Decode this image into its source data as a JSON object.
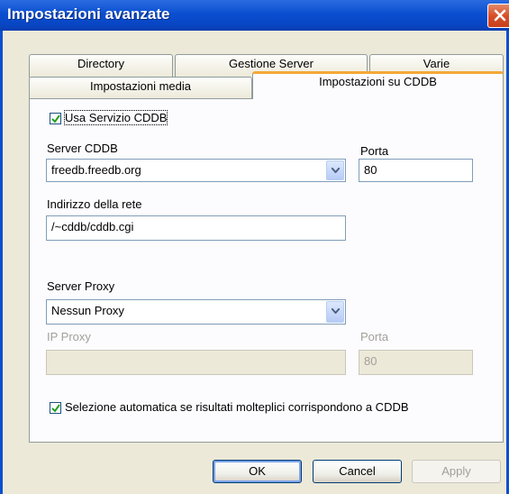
{
  "window": {
    "title": "Impostazioni avanzate"
  },
  "tabs": {
    "row1": [
      "Directory",
      "Gestione Server",
      "Varie"
    ],
    "row2": [
      "Impostazioni media",
      "Impostazioni su CDDB"
    ],
    "active": "Impostazioni su CDDB"
  },
  "cddb": {
    "use_service_label": "Usa Servizio CDDB",
    "use_service_checked": true,
    "server_label": "Server CDDB",
    "server_value": "freedb.freedb.org",
    "port_label": "Porta",
    "port_value": "80",
    "address_label": "Indirizzo della rete",
    "address_value": "/~cddb/cddb.cgi"
  },
  "proxy": {
    "server_label": "Server Proxy",
    "server_value": "Nessun Proxy",
    "ip_label": "IP Proxy",
    "ip_value": "",
    "port_label": "Porta",
    "port_value": "80"
  },
  "auto_select": {
    "label": "Selezione automatica se risultati molteplici corrispondono a CDDB",
    "checked": true
  },
  "buttons": {
    "ok": "OK",
    "cancel": "Cancel",
    "apply": "Apply"
  },
  "colors": {
    "titlebar": "#0a4fd0",
    "tab_highlight": "#f4a836",
    "check": "#21a121"
  }
}
